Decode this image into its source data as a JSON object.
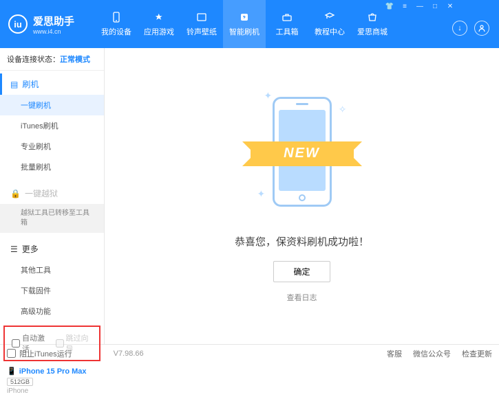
{
  "brand": {
    "title": "爱思助手",
    "sub": "www.i4.cn",
    "logo_letter": "iu"
  },
  "nav": [
    {
      "label": "我的设备"
    },
    {
      "label": "应用游戏"
    },
    {
      "label": "铃声壁纸"
    },
    {
      "label": "智能刷机",
      "active": true
    },
    {
      "label": "工具箱"
    },
    {
      "label": "教程中心"
    },
    {
      "label": "爱思商城"
    }
  ],
  "status": {
    "label": "设备连接状态：",
    "mode": "正常模式"
  },
  "sidebar": {
    "flash_head": "刷机",
    "flash_items": [
      "一键刷机",
      "iTunes刷机",
      "专业刷机",
      "批量刷机"
    ],
    "jailbreak_head": "一键越狱",
    "jailbreak_migrated": "越狱工具已转移至工具箱",
    "more_head": "更多",
    "more_items": [
      "其他工具",
      "下载固件",
      "高级功能"
    ],
    "auto_activate": "自动激活",
    "skip_guide": "跳过向导"
  },
  "device": {
    "name": "iPhone 15 Pro Max",
    "storage": "512GB",
    "type": "iPhone"
  },
  "main": {
    "ribbon": "NEW",
    "message": "恭喜您，保资料刷机成功啦！",
    "ok": "确定",
    "log": "查看日志"
  },
  "footer": {
    "block_itunes": "阻止iTunes运行",
    "version": "V7.98.66",
    "links": [
      "客服",
      "微信公众号",
      "检查更新"
    ]
  }
}
